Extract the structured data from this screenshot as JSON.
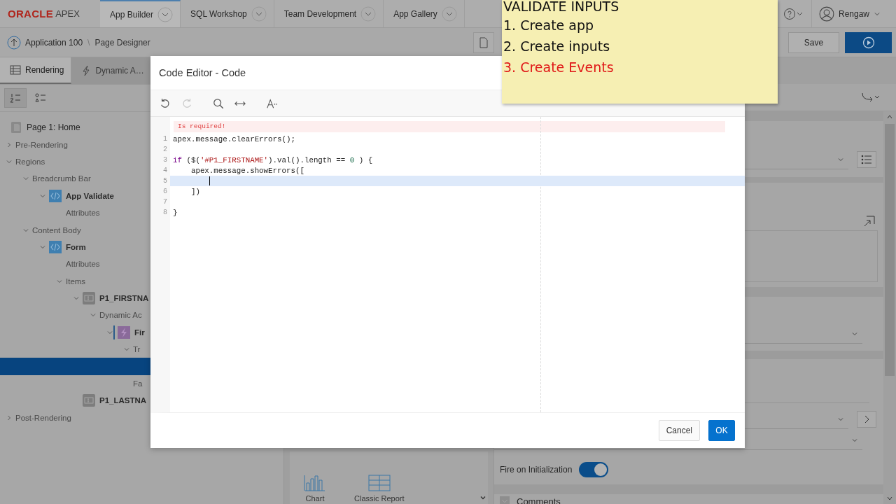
{
  "header": {
    "logo": {
      "brand": "ORACLE",
      "product": "APEX"
    },
    "tabs": [
      {
        "label": "App Builder",
        "selected": true
      },
      {
        "label": "SQL Workshop",
        "selected": false
      },
      {
        "label": "Team Development",
        "selected": false
      },
      {
        "label": "App Gallery",
        "selected": false
      }
    ],
    "user": "Rengaw"
  },
  "toolbar": {
    "breadcrumb": [
      "Application 100",
      "Page Designer"
    ],
    "separator": "\\",
    "save": "Save"
  },
  "left_panel": {
    "tabs": [
      {
        "label": "Rendering",
        "kind": "rendering",
        "selected": true
      },
      {
        "label": "Dynamic A…",
        "kind": "dynamic",
        "selected": false
      }
    ],
    "view_buttons": [
      {
        "kind": "numbered",
        "selected": true
      },
      {
        "kind": "grouped",
        "selected": false
      }
    ],
    "tree": [
      {
        "label": "Page 1: Home",
        "kind": "page",
        "selected": false,
        "children": [
          {
            "label": "Pre-Rendering",
            "expanded": false,
            "selected": false
          },
          {
            "label": "Regions",
            "expanded": true,
            "selected": false,
            "children": [
              {
                "label": "Breadcrumb Bar",
                "expanded": true,
                "selected": false,
                "children": [
                  {
                    "label": "App Validate",
                    "kind": "region",
                    "expanded": true,
                    "selected": false,
                    "children": [
                      {
                        "label": "Attributes",
                        "selected": false
                      }
                    ]
                  }
                ]
              },
              {
                "label": "Content Body",
                "expanded": true,
                "selected": false,
                "children": [
                  {
                    "label": "Form",
                    "kind": "region",
                    "expanded": true,
                    "selected": false,
                    "children": [
                      {
                        "label": "Attributes",
                        "selected": false
                      },
                      {
                        "label": "Items",
                        "expanded": true,
                        "selected": false,
                        "children": [
                          {
                            "label": "P1_FIRSTNA",
                            "kind": "item",
                            "expanded": true,
                            "selected": false,
                            "children": [
                              {
                                "label": "Dynamic Ac",
                                "expanded": true,
                                "selected": false,
                                "children": [
                                  {
                                    "label": "Fir",
                                    "kind": "action",
                                    "expanded": true,
                                    "selected": false,
                                    "children": [
                                      {
                                        "label": "Tr",
                                        "expanded": true,
                                        "selected": false,
                                        "children": [
                                          {
                                            "selected": true
                                          }
                                        ]
                                      },
                                      {
                                        "label": "Fa",
                                        "selected": false
                                      }
                                    ]
                                  }
                                ]
                              }
                            ]
                          },
                          {
                            "label": "P1_LASTNA",
                            "kind": "item",
                            "selected": false
                          }
                        ]
                      }
                    ]
                  }
                ]
              }
            ]
          },
          {
            "label": "Post-Rendering",
            "expanded": false,
            "selected": false
          }
        ]
      }
    ]
  },
  "gallery": [
    {
      "label": "Chart",
      "kind": "chart"
    },
    {
      "label": "Classic Report",
      "kind": "report"
    }
  ],
  "properties": {
    "fire_on_initialization": {
      "label": "Fire on Initialization",
      "on": true
    },
    "comments": {
      "label": "Comments"
    }
  },
  "dialog": {
    "title": "Code Editor - Code",
    "tools": [
      {
        "kind": "undo",
        "disabled": false
      },
      {
        "kind": "redo",
        "disabled": true
      },
      {
        "kind": "search",
        "disabled": false
      },
      {
        "kind": "wrap",
        "disabled": false
      },
      {
        "kind": "font",
        "disabled": false
      }
    ],
    "error": "Is required!",
    "lines": [
      {
        "number": "1",
        "current": false,
        "tokens": [
          {
            "text": "apex.message.clearErrors();",
            "kind": "plain"
          }
        ]
      },
      {
        "number": "2",
        "current": false
      },
      {
        "number": "3",
        "current": false,
        "tokens": [
          {
            "text": "if",
            "kind": "keyword"
          },
          {
            "text": " ($(",
            "kind": "plain"
          },
          {
            "text": "'#P1_FIRSTNAME'",
            "kind": "string"
          },
          {
            "text": ").val().length == ",
            "kind": "plain"
          },
          {
            "text": "0",
            "kind": "number"
          },
          {
            "text": " ) {",
            "kind": "plain"
          }
        ]
      },
      {
        "number": "4",
        "current": false,
        "tokens": [
          {
            "text": "    apex.message.showErrors([",
            "kind": "plain"
          }
        ]
      },
      {
        "number": "5",
        "current": true
      },
      {
        "number": "6",
        "current": false,
        "tokens": [
          {
            "text": "    ])",
            "kind": "plain"
          }
        ]
      },
      {
        "number": "7",
        "current": false
      },
      {
        "number": "8",
        "current": false,
        "tokens": [
          {
            "text": "}",
            "kind": "plain"
          }
        ]
      }
    ],
    "buttons": [
      {
        "label": "Cancel",
        "kind": "secondary"
      },
      {
        "label": "OK",
        "kind": "primary"
      }
    ]
  },
  "note": {
    "title": "VALIDATE INPUTS",
    "steps": [
      {
        "text": "1. Create app",
        "current": false
      },
      {
        "text": "2. Create inputs",
        "current": false
      },
      {
        "text": "3. Create Events",
        "current": true
      }
    ]
  }
}
